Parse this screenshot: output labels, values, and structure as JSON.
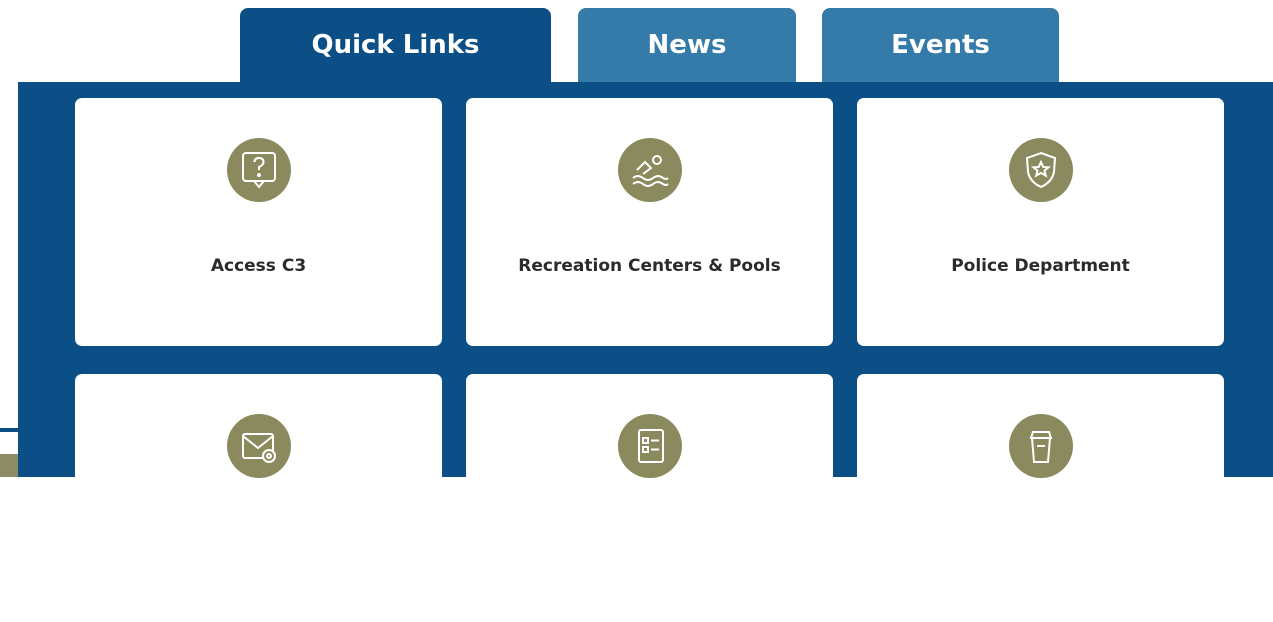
{
  "tabs": [
    {
      "label": "Quick Links",
      "active": true
    },
    {
      "label": "News",
      "active": false
    },
    {
      "label": "Events",
      "active": false
    }
  ],
  "quick_links": [
    {
      "label": "Access C3",
      "icon": "question-chat-icon"
    },
    {
      "label": "Recreation Centers & Pools",
      "icon": "swimmer-icon"
    },
    {
      "label": "Police Department",
      "icon": "police-badge-icon"
    },
    {
      "label": "",
      "icon": "mail-location-icon"
    },
    {
      "label": "",
      "icon": "document-form-icon"
    },
    {
      "label": "",
      "icon": "trash-bin-icon"
    }
  ],
  "colors": {
    "primary": "#0b4f86",
    "tab_inactive": "#357ba9",
    "icon_circle": "#8a8a5e",
    "card": "#ffffff"
  }
}
